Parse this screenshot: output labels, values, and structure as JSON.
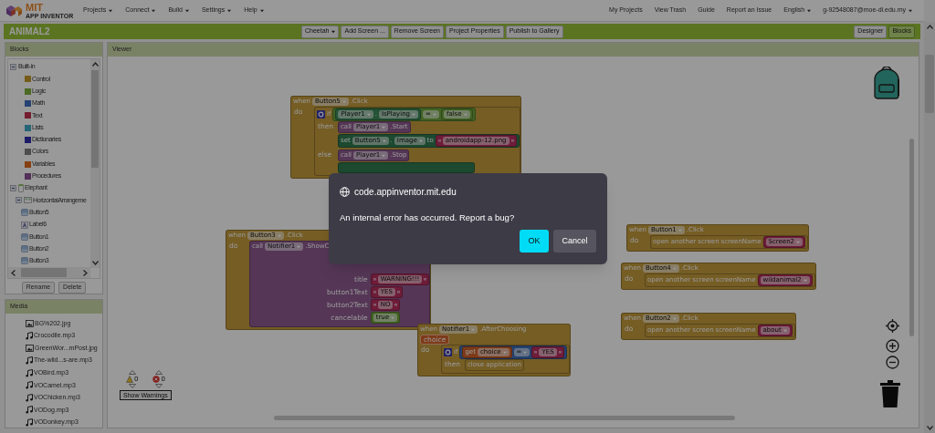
{
  "top_bar": {
    "logo": {
      "title": "MIT",
      "subtitle": "APP INVENTOR"
    },
    "menus": [
      {
        "label": "Projects",
        "dropdown": true
      },
      {
        "label": "Connect",
        "dropdown": true
      },
      {
        "label": "Build",
        "dropdown": true
      },
      {
        "label": "Settings",
        "dropdown": true
      },
      {
        "label": "Help",
        "dropdown": true
      }
    ],
    "links": [
      {
        "label": "My Projects",
        "dropdown": false
      },
      {
        "label": "View Trash",
        "dropdown": false
      },
      {
        "label": "Guide",
        "dropdown": false
      },
      {
        "label": "Report an Issue",
        "dropdown": false
      },
      {
        "label": "English",
        "dropdown": true
      },
      {
        "label": "g-92548087@moe-dl.edu.my",
        "dropdown": true
      }
    ]
  },
  "project_bar": {
    "title": "ANIMAL2",
    "buttons": [
      {
        "label": "Cheetah",
        "dropdown": true
      },
      {
        "label": "Add Screen ...",
        "dropdown": false
      },
      {
        "label": "Remove Screen",
        "dropdown": false
      },
      {
        "label": "Project Properties",
        "dropdown": false
      },
      {
        "label": "Publish to Gallery",
        "dropdown": false
      }
    ],
    "views": [
      {
        "label": "Designer",
        "selected": false
      },
      {
        "label": "Blocks",
        "selected": true
      }
    ]
  },
  "blocks_panel": {
    "title": "Blocks",
    "tree": [
      {
        "label": "Built-in",
        "kind": "group",
        "expanded": true,
        "children": [
          {
            "label": "Control",
            "kind": "category",
            "color": "#765c1a"
          },
          {
            "label": "Logic",
            "kind": "category",
            "color": "#4c6a24"
          },
          {
            "label": "Math",
            "kind": "category",
            "color": "#264373"
          },
          {
            "label": "Text",
            "kind": "category",
            "color": "#731d2f"
          },
          {
            "label": "Lists",
            "kind": "category",
            "color": "#266578"
          },
          {
            "label": "Dictionaries",
            "kind": "category",
            "color": "#1b1b67"
          },
          {
            "label": "Colors",
            "kind": "category",
            "color": "#4d4d4d"
          },
          {
            "label": "Variables",
            "kind": "category",
            "color": "#864013"
          },
          {
            "label": "Procedures",
            "kind": "category",
            "color": "#532f5a"
          }
        ]
      },
      {
        "label": "Elephant",
        "kind": "screen",
        "expanded": true,
        "children": [
          {
            "label": "HorizontalArrangeme",
            "kind": "arrangement",
            "expanded": true,
            "children": [
              {
                "label": "Button5",
                "kind": "button"
              },
              {
                "label": "Label6",
                "kind": "label"
              },
              {
                "label": "Button1",
                "kind": "button"
              },
              {
                "label": "Button2",
                "kind": "button"
              },
              {
                "label": "Button3",
                "kind": "button"
              }
            ]
          }
        ]
      }
    ],
    "buttons": [
      "Rename",
      "Delete"
    ]
  },
  "media_panel": {
    "title": "Media",
    "files": [
      {
        "name": "BG%202.jpg",
        "kind": "image"
      },
      {
        "name": "Crocodile.mp3",
        "kind": "audio"
      },
      {
        "name": "GreenWor...mPost.jpg",
        "kind": "image"
      },
      {
        "name": "The-wild...s-are.mp3",
        "kind": "audio"
      },
      {
        "name": "VOBird.mp3",
        "kind": "audio"
      },
      {
        "name": "VOCamel.mp3",
        "kind": "audio"
      },
      {
        "name": "VOChicken.mp3",
        "kind": "audio"
      },
      {
        "name": "VODog.mp3",
        "kind": "audio"
      },
      {
        "name": "VODonkey.mp3",
        "kind": "audio"
      }
    ]
  },
  "viewer": {
    "title": "Viewer",
    "blocks": [
      {
        "kind": "event",
        "rows": [
          [
            {
              "kind": "word",
              "text": "when"
            },
            {
              "kind": "dropdown",
              "text": "Button5"
            },
            {
              "kind": "word",
              "text": ".Click"
            }
          ]
        ],
        "branches": [
          {
            "label": "do",
            "body": [
              {
                "kind": "if",
                "rows": [
                  [
                    {
                      "kind": "gear"
                    },
                    {
                      "kind": "word",
                      "text": "if"
                    },
                    {
                      "kind": "block",
                      "block": {
                        "kind": "logic_compare",
                        "rows": [
                          [
                            {
                              "kind": "block",
                              "block": {
                                "kind": "getter",
                                "rows": [
                                  [
                                    {
                                      "kind": "dropdown",
                                      "text": "Player1"
                                    },
                                    {
                                      "kind": "word",
                                      "text": "."
                                    },
                                    {
                                      "kind": "dropdown",
                                      "text": "IsPlaying"
                                    }
                                  ]
                                ]
                              }
                            },
                            {
                              "kind": "dropdown",
                              "text": "="
                            },
                            {
                              "kind": "block",
                              "block": {
                                "kind": "logic",
                                "rows": [
                                  [
                                    {
                                      "kind": "dropdown",
                                      "text": "false"
                                    }
                                  ]
                                ]
                              }
                            }
                          ]
                        ]
                      }
                    }
                  ]
                ],
                "branches": [
                  {
                    "label": "then",
                    "body": [
                      {
                        "kind": "call",
                        "rows": [
                          [
                            {
                              "kind": "word",
                              "text": "call"
                            },
                            {
                              "kind": "dropdown",
                              "text": "Player1"
                            },
                            {
                              "kind": "word",
                              "text": ".Start"
                            }
                          ]
                        ]
                      },
                      {
                        "kind": "set",
                        "rows": [
                          [
                            {
                              "kind": "word",
                              "text": "set"
                            },
                            {
                              "kind": "dropdown",
                              "text": "Button5"
                            },
                            {
                              "kind": "word",
                              "text": "."
                            },
                            {
                              "kind": "dropdown",
                              "text": "Image"
                            },
                            {
                              "kind": "word",
                              "text": "to"
                            },
                            {
                              "kind": "block",
                              "block": {
                                "kind": "text",
                                "rows": [
                                  [
                                    {
                                      "kind": "quote"
                                    },
                                    {
                                      "kind": "field",
                                      "text": "androidapp-12.png"
                                    },
                                    {
                                      "kind": "quote"
                                    }
                                  ]
                                ]
                              }
                            }
                          ]
                        ]
                      }
                    ]
                  },
                  {
                    "label": "else",
                    "body": [
                      {
                        "kind": "call",
                        "rows": [
                          [
                            {
                              "kind": "word",
                              "text": "call"
                            },
                            {
                              "kind": "dropdown",
                              "text": "Player1"
                            },
                            {
                              "kind": "word",
                              "text": ".Stop"
                            }
                          ]
                        ]
                      },
                      {
                        "kind": "set"
                      }
                    ]
                  }
                ]
              }
            ]
          }
        ]
      },
      {
        "kind": "event",
        "rows": [
          [
            {
              "kind": "word",
              "text": "when"
            },
            {
              "kind": "dropdown",
              "text": "Button3"
            },
            {
              "kind": "word",
              "text": ".Click"
            }
          ]
        ],
        "branches": [
          {
            "label": "do",
            "body": [
              {
                "kind": "call",
                "rows": [
                  [
                    {
                      "kind": "word",
                      "text": "call"
                    },
                    {
                      "kind": "dropdown",
                      "text": "Notifier1"
                    },
                    {
                      "kind": "word",
                      "text": ".ShowC"
                    }
                  ]
                ],
                "args": [
                  {
                    "label": "title",
                    "input": {
                      "kind": "text",
                      "rows": [
                        [
                          {
                            "kind": "quote"
                          },
                          {
                            "kind": "field",
                            "text": "WARNING!!!"
                          },
                          {
                            "kind": "quote"
                          }
                        ]
                      ]
                    }
                  },
                  {
                    "label": "button1Text",
                    "input": {
                      "kind": "text",
                      "rows": [
                        [
                          {
                            "kind": "quote"
                          },
                          {
                            "kind": "field",
                            "text": "YES"
                          },
                          {
                            "kind": "quote"
                          }
                        ]
                      ]
                    }
                  },
                  {
                    "label": "button2Text",
                    "input": {
                      "kind": "text",
                      "rows": [
                        [
                          {
                            "kind": "quote"
                          },
                          {
                            "kind": "field",
                            "text": "NO"
                          },
                          {
                            "kind": "quote"
                          }
                        ]
                      ]
                    }
                  },
                  {
                    "label": "cancelable",
                    "input": {
                      "kind": "logic",
                      "rows": [
                        [
                          {
                            "kind": "dropdown",
                            "text": "true"
                          }
                        ]
                      ]
                    }
                  }
                ]
              }
            ]
          }
        ]
      },
      {
        "kind": "event",
        "rows": [
          [
            {
              "kind": "word",
              "text": "when"
            },
            {
              "kind": "dropdown",
              "text": "Notifier1"
            },
            {
              "kind": "word",
              "text": ".AfterChoosing"
            }
          ],
          [
            {
              "kind": "param",
              "text": "choice"
            }
          ]
        ],
        "branches": [
          {
            "label": "do",
            "body": [
              {
                "kind": "if",
                "rows": [
                  [
                    {
                      "kind": "gear"
                    },
                    {
                      "kind": "word",
                      "text": "if"
                    },
                    {
                      "kind": "block",
                      "block": {
                        "kind": "compare",
                        "rows": [
                          [
                            {
                              "kind": "block",
                              "block": {
                                "kind": "get",
                                "rows": [
                                  [
                                    {
                                      "kind": "word",
                                      "text": "get"
                                    },
                                    {
                                      "kind": "dropdown",
                                      "text": "choice"
                                    }
                                  ]
                                ]
                              }
                            },
                            {
                              "kind": "dropdown",
                              "text": "="
                            },
                            {
                              "kind": "block",
                              "block": {
                                "kind": "text",
                                "rows": [
                                  [
                                    {
                                      "kind": "quote"
                                    },
                                    {
                                      "kind": "field",
                                      "text": "YES"
                                    },
                                    {
                                      "kind": "quote"
                                    }
                                  ]
                                ]
                              }
                            }
                          ]
                        ]
                      }
                    }
                  ]
                ],
                "branches": [
                  {
                    "label": "then",
                    "body": [
                      {
                        "kind": "open",
                        "rows": [
                          [
                            {
                              "kind": "word",
                              "text": "close application"
                            }
                          ]
                        ]
                      }
                    ]
                  }
                ]
              }
            ]
          }
        ]
      },
      {
        "kind": "event",
        "rows": [
          [
            {
              "kind": "word",
              "text": "when"
            },
            {
              "kind": "dropdown",
              "text": "Button1"
            },
            {
              "kind": "word",
              "text": ".Click"
            }
          ]
        ],
        "branches": [
          {
            "label": "do",
            "body": [
              {
                "kind": "open",
                "rows": [
                  [
                    {
                      "kind": "word",
                      "text": "open another screen"
                    },
                    {
                      "kind": "word",
                      "text": "screenName"
                    },
                    {
                      "kind": "block",
                      "block": {
                        "kind": "text",
                        "rows": [
                          [
                            {
                              "kind": "dropdown",
                              "text": "Screen2"
                            }
                          ]
                        ]
                      }
                    }
                  ]
                ]
              }
            ]
          }
        ]
      },
      {
        "kind": "event",
        "rows": [
          [
            {
              "kind": "word",
              "text": "when"
            },
            {
              "kind": "dropdown",
              "text": "Button4"
            },
            {
              "kind": "word",
              "text": ".Click"
            }
          ]
        ],
        "branches": [
          {
            "label": "do",
            "body": [
              {
                "kind": "open",
                "rows": [
                  [
                    {
                      "kind": "word",
                      "text": "open another screen"
                    },
                    {
                      "kind": "word",
                      "text": "screenName"
                    },
                    {
                      "kind": "block",
                      "block": {
                        "kind": "text",
                        "rows": [
                          [
                            {
                              "kind": "dropdown",
                              "text": "wildanimal2"
                            }
                          ]
                        ]
                      }
                    }
                  ]
                ]
              }
            ]
          }
        ]
      },
      {
        "kind": "event",
        "rows": [
          [
            {
              "kind": "word",
              "text": "when"
            },
            {
              "kind": "dropdown",
              "text": "Button2"
            },
            {
              "kind": "word",
              "text": ".Click"
            }
          ]
        ],
        "branches": [
          {
            "label": "do",
            "body": [
              {
                "kind": "open",
                "rows": [
                  [
                    {
                      "kind": "word",
                      "text": "open another screen"
                    },
                    {
                      "kind": "word",
                      "text": "screenName"
                    },
                    {
                      "kind": "block",
                      "block": {
                        "kind": "text",
                        "rows": [
                          [
                            {
                              "kind": "dropdown",
                              "text": "about"
                            }
                          ]
                        ]
                      }
                    }
                  ]
                ]
              }
            ]
          }
        ]
      }
    ],
    "warnings": {
      "warning_count": "0",
      "error_count": "0",
      "button": "Show Warnings"
    }
  },
  "dialog": {
    "origin": "code.appinventor.mit.edu",
    "message": "An internal error has occurred. Report a bug?",
    "buttons": [
      {
        "label": "OK",
        "primary": true
      },
      {
        "label": "Cancel",
        "primary": false
      }
    ]
  }
}
